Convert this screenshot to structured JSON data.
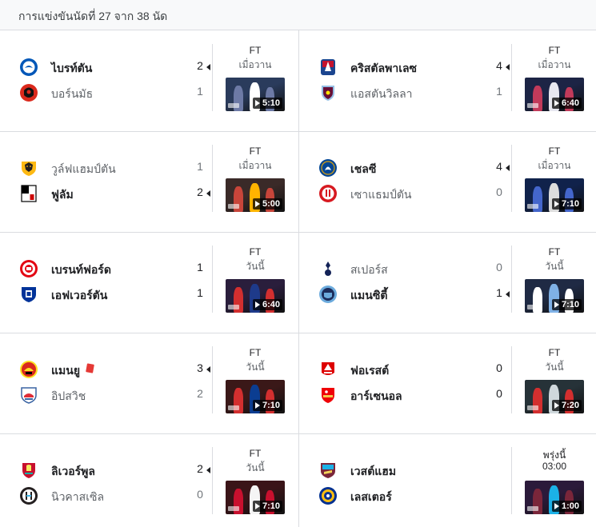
{
  "header": {
    "title": "การแข่งขันนัดที่ 27 จาก 38 นัด"
  },
  "matches": [
    {
      "home": "ไบรท์ตัน",
      "home_score": "2",
      "away": "บอร์นมัธ",
      "away_score": "1",
      "winner": "home",
      "status": "FT",
      "when": "เมื่อวาน",
      "video": "5:10",
      "home_logo": "brighton-crest-icon",
      "away_logo": "bournemouth-crest-icon"
    },
    {
      "home": "คริสตัลพาเลซ",
      "home_score": "4",
      "away": "แอสตันวิลลา",
      "away_score": "1",
      "winner": "home",
      "status": "FT",
      "when": "เมื่อวาน",
      "video": "6:40",
      "home_logo": "crystal-palace-crest-icon",
      "away_logo": "aston-villa-crest-icon"
    },
    {
      "home": "วูล์ฟแฮมป์ตัน",
      "home_score": "1",
      "away": "ฟูลัม",
      "away_score": "2",
      "winner": "away",
      "status": "FT",
      "when": "เมื่อวาน",
      "video": "5:00",
      "home_logo": "wolves-crest-icon",
      "away_logo": "fulham-crest-icon"
    },
    {
      "home": "เชลซี",
      "home_score": "4",
      "away": "เซาแธมป์ตัน",
      "away_score": "0",
      "winner": "home",
      "status": "FT",
      "when": "เมื่อวาน",
      "video": "7:10",
      "home_logo": "chelsea-crest-icon",
      "away_logo": "southampton-crest-icon"
    },
    {
      "home": "เบรนท์ฟอร์ด",
      "home_score": "1",
      "away": "เอฟเวอร์ตัน",
      "away_score": "1",
      "winner": "draw",
      "status": "FT",
      "when": "วันนี้",
      "video": "6:40",
      "home_logo": "brentford-crest-icon",
      "away_logo": "everton-crest-icon"
    },
    {
      "home": "สเปอร์ส",
      "home_score": "0",
      "away": "แมนซิตี้",
      "away_score": "1",
      "winner": "away",
      "status": "FT",
      "when": "วันนี้",
      "video": "7:10",
      "home_logo": "tottenham-crest-icon",
      "away_logo": "man-city-crest-icon"
    },
    {
      "home": "แมนยู",
      "home_score": "3",
      "away": "อิปสวิช",
      "away_score": "2",
      "winner": "home",
      "status": "FT",
      "when": "วันนี้",
      "video": "7:10",
      "home_logo": "man-united-crest-icon",
      "away_logo": "ipswich-crest-icon",
      "home_red_card": true
    },
    {
      "home": "ฟอเรสต์",
      "home_score": "0",
      "away": "อาร์เซนอล",
      "away_score": "0",
      "winner": "draw",
      "status": "FT",
      "when": "วันนี้",
      "video": "7:20",
      "home_logo": "nottingham-forest-crest-icon",
      "away_logo": "arsenal-crest-icon"
    },
    {
      "home": "ลิเวอร์พูล",
      "home_score": "2",
      "away": "นิวคาสเซิล",
      "away_score": "0",
      "winner": "home",
      "status": "FT",
      "when": "วันนี้",
      "video": "7:10",
      "home_logo": "liverpool-crest-icon",
      "away_logo": "newcastle-crest-icon"
    },
    {
      "home": "เวสต์แฮม",
      "home_score": "",
      "away": "เลสเตอร์",
      "away_score": "",
      "winner": "none",
      "status": "พรุ่งนี้",
      "when": "03:00",
      "video": "1:00",
      "home_logo": "west-ham-crest-icon",
      "away_logo": "leicester-crest-icon"
    }
  ],
  "colors": {
    "border": "#dadce0",
    "header_bg": "#f8f9fa",
    "red_card": "#e53935"
  }
}
